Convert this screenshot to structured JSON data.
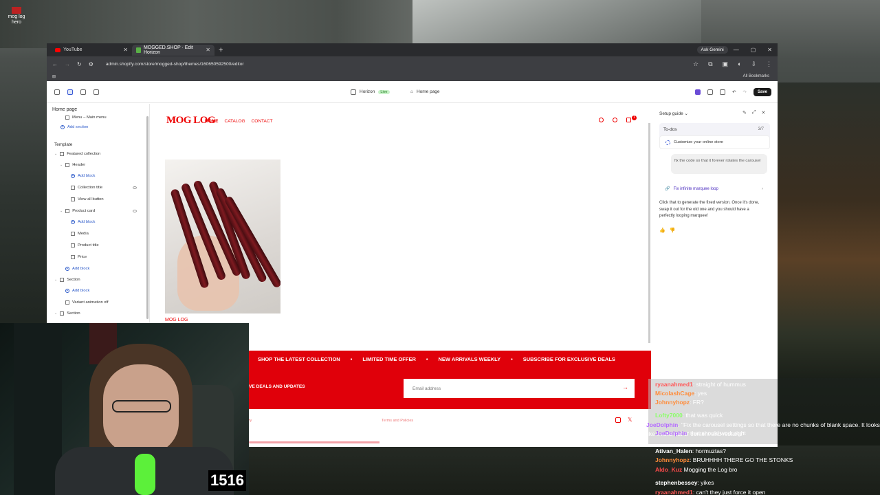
{
  "desktop": {
    "icon_label": "mog log hero"
  },
  "browser": {
    "tabs": [
      {
        "label": "YouTube"
      },
      {
        "label": "MOGGED.SHOP · Edit Horizon"
      }
    ],
    "new_tab": "+",
    "ask_gemini": "Ask Gemini",
    "url": "admin.shopify.com/store/mogged-shop/themes/160650592500/editor",
    "all_bookmarks": "All Bookmarks"
  },
  "editor": {
    "theme_name": "Horizon",
    "live_badge": "Live",
    "page": "Home page",
    "save": "Save"
  },
  "left_panel": {
    "title": "Home page",
    "template_label": "Template",
    "items": [
      {
        "label": "Menu – Main menu"
      },
      {
        "label": "Add section"
      },
      {
        "label": "Featured collection"
      },
      {
        "label": "Header"
      },
      {
        "label": "Add block"
      },
      {
        "label": "Collection title"
      },
      {
        "label": "View all button"
      },
      {
        "label": "Product card"
      },
      {
        "label": "Add block"
      },
      {
        "label": "Media"
      },
      {
        "label": "Product title"
      },
      {
        "label": "Price"
      },
      {
        "label": "Add block"
      },
      {
        "label": "Section"
      },
      {
        "label": "Add block"
      },
      {
        "label": "Variant animation off"
      },
      {
        "label": "Section"
      }
    ]
  },
  "store": {
    "logo": "MOG LOG",
    "nav": [
      "HOME",
      "CATALOG",
      "CONTACT"
    ],
    "cart_count": "1",
    "product_name": "MOG LOG",
    "marquee": [
      "SHOP THE LATEST COLLECTION",
      "•",
      "LIMITED TIME OFFER",
      "•",
      "NEW ARRIVALS WEEKLY",
      "•",
      "SUBSCRIBE FOR EXCLUSIVE DEALS"
    ],
    "newsletter_text": "VE DEALS AND UPDATES",
    "email_placeholder": "Email address",
    "footer_left": "fy",
    "footer_terms": "Terms and Policies"
  },
  "setup_guide": {
    "title": "Setup guide",
    "todos_label": "To-dos",
    "todos_count": "3/7",
    "todo_item": "Customize your online store",
    "user_message": "fix the code so that it forever rotates the carousel",
    "fix_link": "Fix infinite marquee loop",
    "response": "Click that to generate the fixed version. Once it's done, swap it out for the old one and you should have a perfectly looping marquee!"
  },
  "webcam": {
    "counter": "1516"
  },
  "chat": [
    {
      "user": "ryaanahmed1",
      "msg": ": straight of hummus",
      "color": "#ff5a5a"
    },
    {
      "user": "MicolashCage",
      "msg": ": yes",
      "color": "#ff8c3a"
    },
    {
      "user": "Johnnyhopz",
      "msg": ": FR?",
      "color": "#ff8c3a"
    },
    {
      "user": "Lofty7000",
      "msg": ": that was quick",
      "color": "#8cff6a"
    },
    {
      "user": "JoeDolphin",
      "msg": ": \"Fix the carousel settings so that there are no chunks of blank space. It looks like it runs out of content and restarts\"",
      "color": "#b56cff"
    },
    {
      "user": "JoeDolphin",
      "msg": ": that should work right",
      "color": "#b56cff"
    },
    {
      "user": "Ativan_Halen",
      "msg": ": hormuztas?",
      "color": "#ffffff"
    },
    {
      "user": "Johnnyhopz",
      "msg": ": BRUHHHH THERE GO THE STONKS",
      "color": "#ff8c3a"
    },
    {
      "user": "Aldo_Kuz",
      "msg": " Mogging the Log bro",
      "color": "#ff4a4a"
    },
    {
      "user": "stephenbessey",
      "msg": ": yikes",
      "color": "#ffffff"
    },
    {
      "user": "ryaanahmed1",
      "msg": ": can't they just force it open",
      "color": "#ff5a5a"
    }
  ],
  "colors": {
    "brand_red": "#e0000a",
    "accent_blue": "#2a58c9"
  }
}
